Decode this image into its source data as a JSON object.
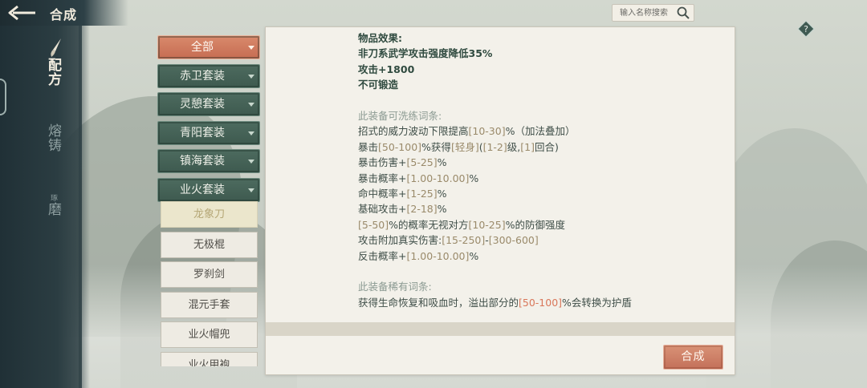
{
  "header": {
    "title": "合成",
    "back_icon": "back-arrow-icon"
  },
  "search": {
    "placeholder": "输入名称搜索",
    "icon": "search-icon"
  },
  "side_tabs": [
    {
      "label": "配方",
      "active": true
    },
    {
      "label": "熔铸",
      "active": false
    },
    {
      "label": "磨",
      "small": "琢",
      "active": false
    }
  ],
  "categories": [
    {
      "label": "全部",
      "selected": true
    },
    {
      "label": "赤卫套装",
      "selected": false
    },
    {
      "label": "灵憩套装",
      "selected": false
    },
    {
      "label": "青阳套装",
      "selected": false
    },
    {
      "label": "镇海套装",
      "selected": false
    },
    {
      "label": "业火套装",
      "selected": false
    }
  ],
  "items": [
    {
      "label": "龙象刀",
      "selected": true
    },
    {
      "label": "无极棍",
      "selected": false
    },
    {
      "label": "罗刹剑",
      "selected": false
    },
    {
      "label": "混元手套",
      "selected": false
    },
    {
      "label": "业火帽兜",
      "selected": false
    },
    {
      "label": "业火甲袍",
      "selected": false
    }
  ],
  "detail": {
    "effect_title": "物品效果:",
    "effect_lines": [
      "非刀系武学攻击强度降低35%",
      "攻击+1800",
      "不可锻造"
    ],
    "refine_title": "此装备可洗练词条:",
    "refine_lines": [
      [
        "招式的威力波动下限提高",
        "[10-30]",
        "%（加法叠加）"
      ],
      [
        "暴击",
        "[50-100]",
        "%获得",
        "[轻身]",
        "(",
        "[1-2]",
        "级,",
        "[1]",
        "回合)"
      ],
      [
        "暴击伤害+",
        "[5-25]",
        "%"
      ],
      [
        "暴击概率+",
        "[1.00-10.00]",
        "%"
      ],
      [
        "命中概率+",
        "[1-25]",
        "%"
      ],
      [
        "基础攻击+",
        "[2-18]",
        "%"
      ],
      [
        "[5-50]",
        "%的概率无视对方",
        "[10-25]",
        "%的防御强度"
      ],
      [
        "攻击附加真实伤害:",
        "[15-250]",
        "-",
        "[300-600]"
      ],
      [
        "反击概率+",
        "[1.00-10.00]",
        "%"
      ]
    ],
    "rare_title": "此装备稀有词条:",
    "rare_line": {
      "pre": "获得生命恢复和吸血时，溢出部分的",
      "hl": "[50-100]",
      "post": "%会转换为护盾"
    }
  },
  "actions": {
    "craft_label": "合成"
  },
  "colors": {
    "accent": "#c66c52",
    "panel": "#f3f1ea",
    "nav": "#2b3d42",
    "category": "#4d6b5f"
  }
}
